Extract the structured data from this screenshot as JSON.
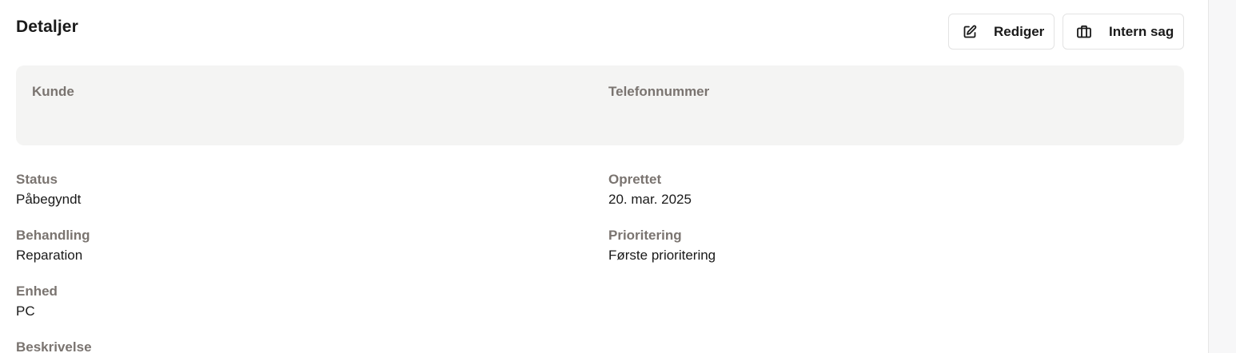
{
  "header": {
    "title": "Detaljer"
  },
  "actions": {
    "edit_label": "Rediger",
    "internal_label": "Intern sag"
  },
  "customer_box": {
    "customer_label": "Kunde",
    "customer_value": "",
    "phone_label": "Telefonnummer",
    "phone_value": ""
  },
  "fields": {
    "status": {
      "label": "Status",
      "value": "Påbegyndt"
    },
    "created": {
      "label": "Oprettet",
      "value": "20. mar. 2025"
    },
    "treatment": {
      "label": "Behandling",
      "value": "Reparation"
    },
    "priority": {
      "label": "Prioritering",
      "value": "Første prioritering"
    },
    "device": {
      "label": "Enhed",
      "value": "PC"
    },
    "description": {
      "label": "Beskrivelse"
    }
  },
  "icons": {
    "edit": "edit-pencil-icon",
    "internal": "briefcase-icon"
  },
  "colors": {
    "label": "#7a7470",
    "box_background": "#f4f4f3",
    "text": "#1a1a1a"
  }
}
